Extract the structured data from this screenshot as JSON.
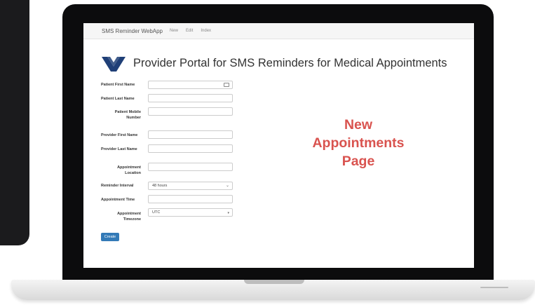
{
  "navbar": {
    "brand": "SMS Reminder WebApp",
    "links": [
      "New",
      "Edit",
      "Index"
    ]
  },
  "header": {
    "title": "Provider Portal for SMS Reminders for Medical Appointments",
    "logo_icon": "va-logo-icon"
  },
  "form": {
    "fields": [
      {
        "label": "Patient First Name",
        "value": ""
      },
      {
        "label": "Patient Last Name",
        "value": ""
      },
      {
        "label": "Patient Mobile Number",
        "value": ""
      },
      {
        "label": "Provider First Name",
        "value": ""
      },
      {
        "label": "Provider Last Name",
        "value": ""
      },
      {
        "label": "Appointment Location",
        "value": ""
      },
      {
        "label": "Reminder Interval",
        "value": "48 hours"
      },
      {
        "label": "Appointment Time",
        "value": ""
      },
      {
        "label": "Appointment Timezone",
        "value": "UTC"
      }
    ],
    "submit_label": "Create"
  },
  "caption": {
    "line1": "New",
    "line2": "Appointments",
    "line3": "Page",
    "color": "#d9534f"
  },
  "colors": {
    "accent": "#337ab7",
    "bezel": "#0c0c0d"
  }
}
